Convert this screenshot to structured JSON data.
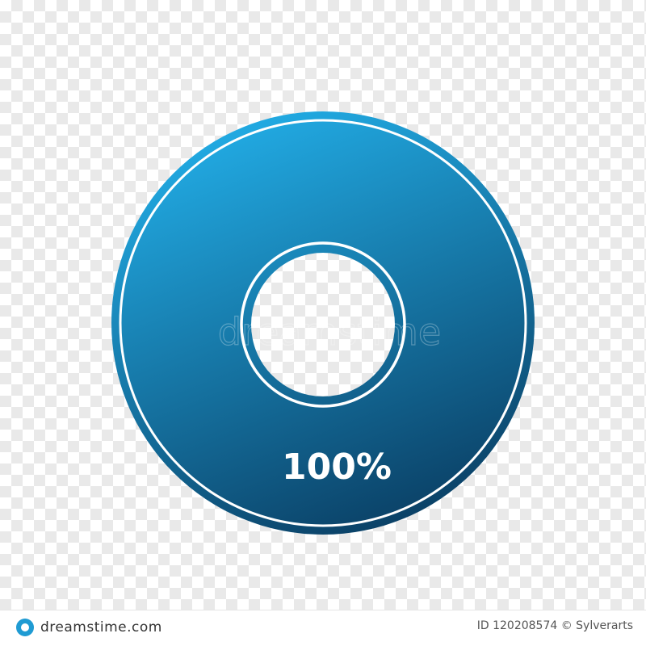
{
  "badge": {
    "percent_text": "100%",
    "progress_fraction": 1.0,
    "gradient_top_color": "#22ade6",
    "gradient_bottom_color": "#0a3e63",
    "ring_color": "#ffffff"
  },
  "watermark": {
    "overlay_text": "dreamstime",
    "footer_brand": "dreamstime.com",
    "footer_id": "ID 120208574 © Sylverarts"
  }
}
